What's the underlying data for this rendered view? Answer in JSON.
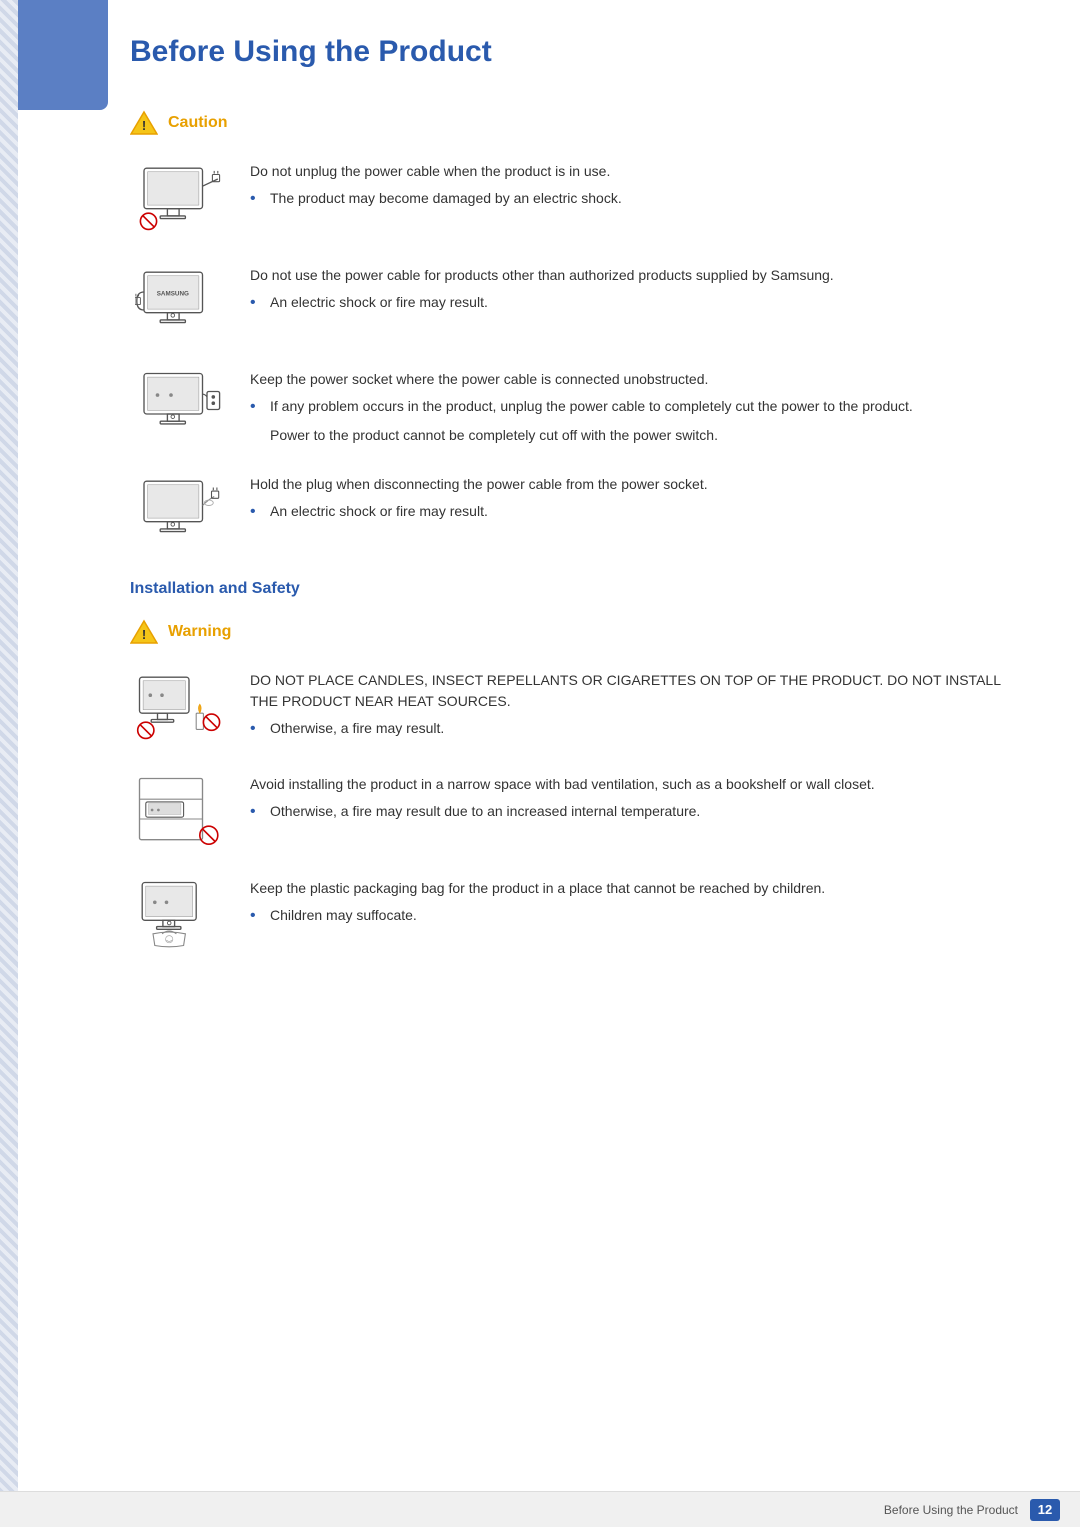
{
  "page": {
    "title": "Before Using the Product",
    "page_number": "12",
    "bottom_label": "Before Using the Product"
  },
  "caution_section": {
    "label": "Caution",
    "items": [
      {
        "id": "caution-1",
        "main_text": "Do not unplug the power cable when the product is in use.",
        "bullet": "The product may become damaged by an electric shock.",
        "extra": null,
        "image_type": "monitor-unplug"
      },
      {
        "id": "caution-2",
        "main_text": "Do not use the power cable for products other than authorized products supplied by Samsung.",
        "bullet": "An electric shock or fire may result.",
        "extra": null,
        "image_type": "monitor-samsung"
      },
      {
        "id": "caution-3",
        "main_text": "Keep the power socket where the power cable is connected unobstructed.",
        "bullet": "If any problem occurs in the product, unplug the power cable to completely cut the power to the product.",
        "extra": "Power to the product cannot be completely cut off with the power switch.",
        "image_type": "monitor-socket"
      },
      {
        "id": "caution-4",
        "main_text": "Hold the plug when disconnecting the power cable from the power socket.",
        "bullet": "An electric shock or fire may result.",
        "extra": null,
        "image_type": "monitor-plug"
      }
    ]
  },
  "installation_section": {
    "heading": "Installation and Safety",
    "warning_label": "Warning",
    "items": [
      {
        "id": "warning-1",
        "main_text": "DO NOT PLACE CANDLES, INSECT REPELLANTS OR CIGARETTES ON TOP OF THE PRODUCT. DO NOT INSTALL THE PRODUCT NEAR HEAT SOURCES.",
        "bullet": "Otherwise, a fire may result.",
        "extra": null,
        "image_type": "monitor-fire"
      },
      {
        "id": "warning-2",
        "main_text": "Avoid installing the product in a narrow space with bad ventilation, such as a bookshelf or wall closet.",
        "bullet": "Otherwise, a fire may result due to an increased internal temperature.",
        "extra": null,
        "image_type": "monitor-shelf"
      },
      {
        "id": "warning-3",
        "main_text": "Keep the plastic packaging bag for the product in a place that cannot be reached by children.",
        "bullet": "Children may suffocate.",
        "extra": null,
        "image_type": "monitor-bag"
      }
    ]
  }
}
